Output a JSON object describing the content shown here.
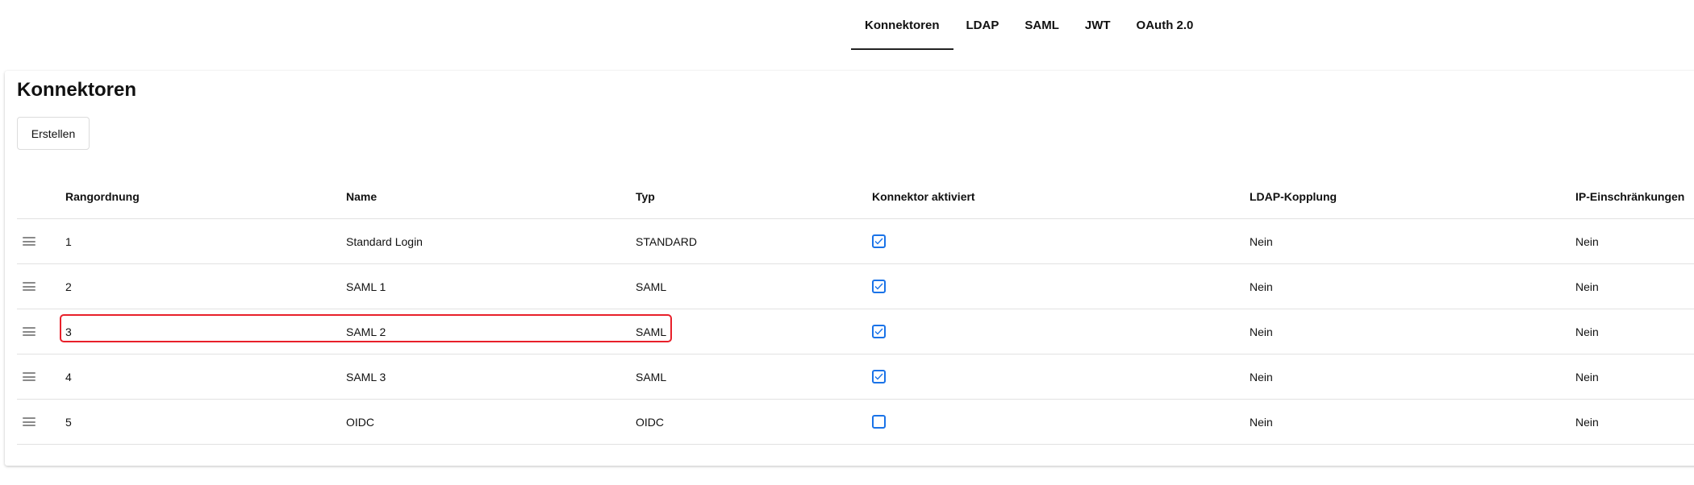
{
  "tabs": [
    {
      "label": "Konnektoren",
      "active": true
    },
    {
      "label": "LDAP",
      "active": false
    },
    {
      "label": "SAML",
      "active": false
    },
    {
      "label": "JWT",
      "active": false
    },
    {
      "label": "OAuth 2.0",
      "active": false
    }
  ],
  "page": {
    "title": "Konnektoren",
    "create_label": "Erstellen"
  },
  "table": {
    "headers": {
      "rank": "Rangordnung",
      "name": "Name",
      "typ": "Typ",
      "activated": "Konnektor aktiviert",
      "ldap": "LDAP-Kopplung",
      "ip": "IP-Einschränkungen"
    },
    "rows": [
      {
        "rank": "1",
        "name": "Standard Login",
        "typ": "STANDARD",
        "activated": true,
        "ldap": "Nein",
        "ip": "Nein"
      },
      {
        "rank": "2",
        "name": "SAML 1",
        "typ": "SAML",
        "activated": true,
        "ldap": "Nein",
        "ip": "Nein"
      },
      {
        "rank": "3",
        "name": "SAML 2",
        "typ": "SAML",
        "activated": true,
        "ldap": "Nein",
        "ip": "Nein",
        "highlighted": true
      },
      {
        "rank": "4",
        "name": "SAML 3",
        "typ": "SAML",
        "activated": true,
        "ldap": "Nein",
        "ip": "Nein"
      },
      {
        "rank": "5",
        "name": "OIDC",
        "typ": "OIDC",
        "activated": false,
        "ldap": "Nein",
        "ip": "Nein"
      }
    ]
  },
  "colors": {
    "accent": "#1a73e8",
    "highlight": "#e8202a",
    "divider": "#e2e2e2"
  },
  "icons": {
    "drag": "drag-handle-icon",
    "check": "checkmark-icon"
  }
}
